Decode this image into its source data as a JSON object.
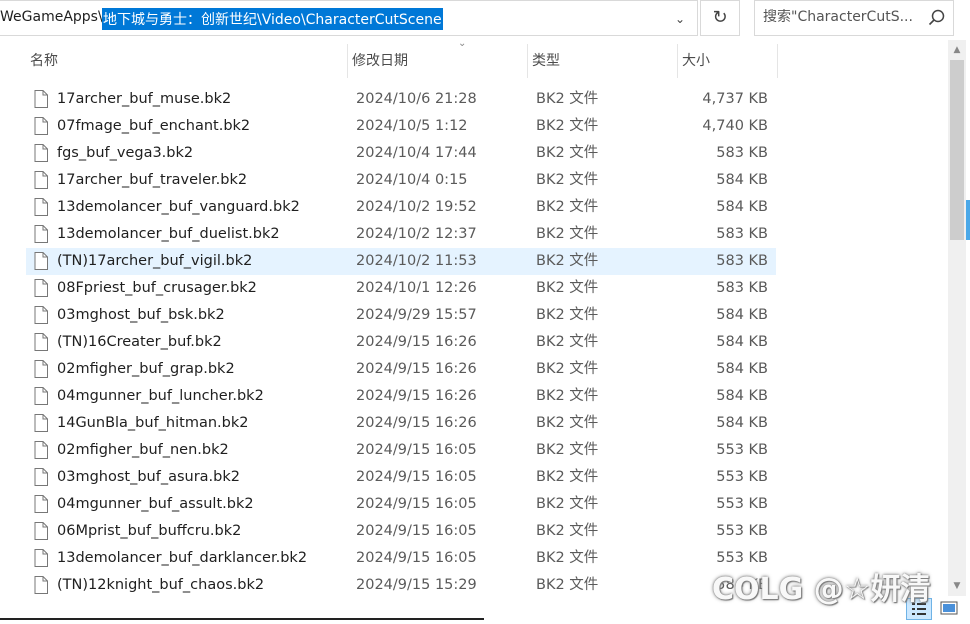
{
  "address": {
    "path_prefix": "WeGameApps\\",
    "path_selected": "地下城与勇士：创新世纪\\Video\\CharacterCutScene"
  },
  "search": {
    "placeholder": "搜索\"CharacterCutS..."
  },
  "columns": {
    "name": "名称",
    "date": "修改日期",
    "type": "类型",
    "size": "大小"
  },
  "files": [
    {
      "name": "17archer_buf_muse.bk2",
      "date": "2024/10/6 21:28",
      "type": "BK2 文件",
      "size": "4,737 KB"
    },
    {
      "name": "07fmage_buf_enchant.bk2",
      "date": "2024/10/5 1:12",
      "type": "BK2 文件",
      "size": "4,740 KB"
    },
    {
      "name": "fgs_buf_vega3.bk2",
      "date": "2024/10/4 17:44",
      "type": "BK2 文件",
      "size": "583 KB"
    },
    {
      "name": "17archer_buf_traveler.bk2",
      "date": "2024/10/4 0:15",
      "type": "BK2 文件",
      "size": "584 KB"
    },
    {
      "name": "13demolancer_buf_vanguard.bk2",
      "date": "2024/10/2 19:52",
      "type": "BK2 文件",
      "size": "584 KB"
    },
    {
      "name": "13demolancer_buf_duelist.bk2",
      "date": "2024/10/2 12:37",
      "type": "BK2 文件",
      "size": "583 KB"
    },
    {
      "name": "(TN)17archer_buf_vigil.bk2",
      "date": "2024/10/2 11:53",
      "type": "BK2 文件",
      "size": "583 KB"
    },
    {
      "name": "08Fpriest_buf_crusager.bk2",
      "date": "2024/10/1 12:26",
      "type": "BK2 文件",
      "size": "583 KB"
    },
    {
      "name": "03mghost_buf_bsk.bk2",
      "date": "2024/9/29 15:57",
      "type": "BK2 文件",
      "size": "584 KB"
    },
    {
      "name": "(TN)16Creater_buf.bk2",
      "date": "2024/9/15 16:26",
      "type": "BK2 文件",
      "size": "584 KB"
    },
    {
      "name": "02mfigher_buf_grap.bk2",
      "date": "2024/9/15 16:26",
      "type": "BK2 文件",
      "size": "584 KB"
    },
    {
      "name": "04mgunner_buf_luncher.bk2",
      "date": "2024/9/15 16:26",
      "type": "BK2 文件",
      "size": "584 KB"
    },
    {
      "name": "14GunBla_buf_hitman.bk2",
      "date": "2024/9/15 16:26",
      "type": "BK2 文件",
      "size": "584 KB"
    },
    {
      "name": "02mfigher_buf_nen.bk2",
      "date": "2024/9/15 16:05",
      "type": "BK2 文件",
      "size": "553 KB"
    },
    {
      "name": "03mghost_buf_asura.bk2",
      "date": "2024/9/15 16:05",
      "type": "BK2 文件",
      "size": "553 KB"
    },
    {
      "name": "04mgunner_buf_assult.bk2",
      "date": "2024/9/15 16:05",
      "type": "BK2 文件",
      "size": "553 KB"
    },
    {
      "name": "06Mprist_buf_buffcru.bk2",
      "date": "2024/9/15 16:05",
      "type": "BK2 文件",
      "size": "553 KB"
    },
    {
      "name": "13demolancer_buf_darklancer.bk2",
      "date": "2024/9/15 16:05",
      "type": "BK2 文件",
      "size": "553 KB"
    },
    {
      "name": "(TN)12knight_buf_chaos.bk2",
      "date": "2024/9/15 15:29",
      "type": "BK2 文件",
      "size": "584 KB"
    }
  ],
  "hover_row_index": 6,
  "watermark": "COLG @☆妍清",
  "icons": {
    "dropdown": "chevron-down-icon",
    "refresh": "refresh-icon",
    "search": "search-icon",
    "file": "file-icon",
    "details_view": "details-view-icon",
    "large_icons_view": "large-icons-view-icon"
  },
  "colors": {
    "selection": "#0078d7",
    "hover": "#e5f3ff"
  }
}
